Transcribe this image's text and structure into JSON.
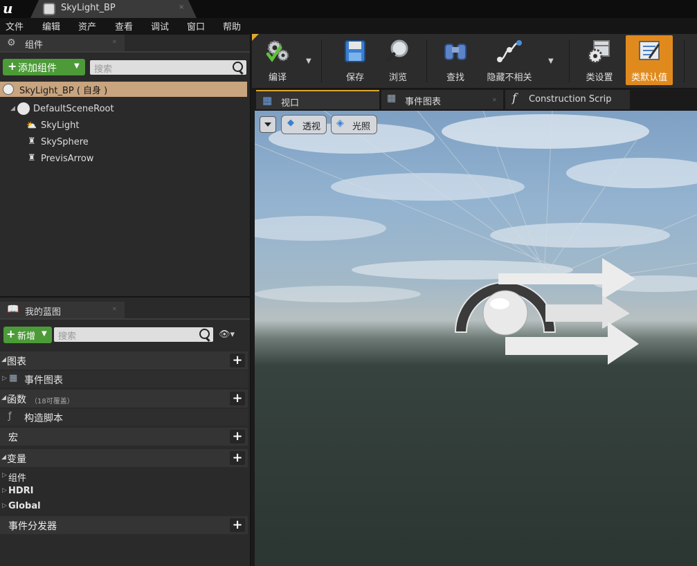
{
  "window": {
    "tab_title": "SkyLight_BP",
    "tab_close": "×",
    "logo_text": "u"
  },
  "menu": [
    "文件",
    "编辑",
    "资产",
    "查看",
    "调试",
    "窗口",
    "帮助"
  ],
  "components_panel": {
    "title": "组件",
    "add_button": "添加组件",
    "search_placeholder": "搜索",
    "self_row": "SkyLight_BP ( 自身 )",
    "tree": [
      {
        "label": "DefaultSceneRoot",
        "icon": "scene-root-icon"
      },
      {
        "label": "SkyLight",
        "icon": "skylight-icon"
      },
      {
        "label": "SkySphere",
        "icon": "scene-component-icon"
      },
      {
        "label": "PrevisArrow",
        "icon": "scene-component-icon"
      }
    ]
  },
  "blueprint_panel": {
    "title": "我的蓝图",
    "new_button": "新增",
    "search_placeholder": "搜索",
    "sections": {
      "graphs": "图表",
      "event_graph": "事件图表",
      "functions": "函数",
      "functions_note": "（18可覆盖）",
      "construction_script": "构造脚本",
      "macros": "宏",
      "variables": "变量",
      "var_components": "组件",
      "var_hdri": "HDRI",
      "var_global": "Global",
      "dispatchers": "事件分发器"
    }
  },
  "toolbar": {
    "compile": "编译",
    "save": "保存",
    "browse": "浏览",
    "find": "查找",
    "hide_unrelated": "隐藏不相关",
    "class_settings": "类设置",
    "class_defaults": "类默认值"
  },
  "editor_tabs": [
    "视口",
    "事件图表",
    "Construction Scrip"
  ],
  "viewport": {
    "perspective": "透视",
    "lit": "光照"
  },
  "colors": {
    "accent_green": "#4c9b38",
    "selected_row": "#c8a47f",
    "active_toolbar": "#e08a1e"
  }
}
